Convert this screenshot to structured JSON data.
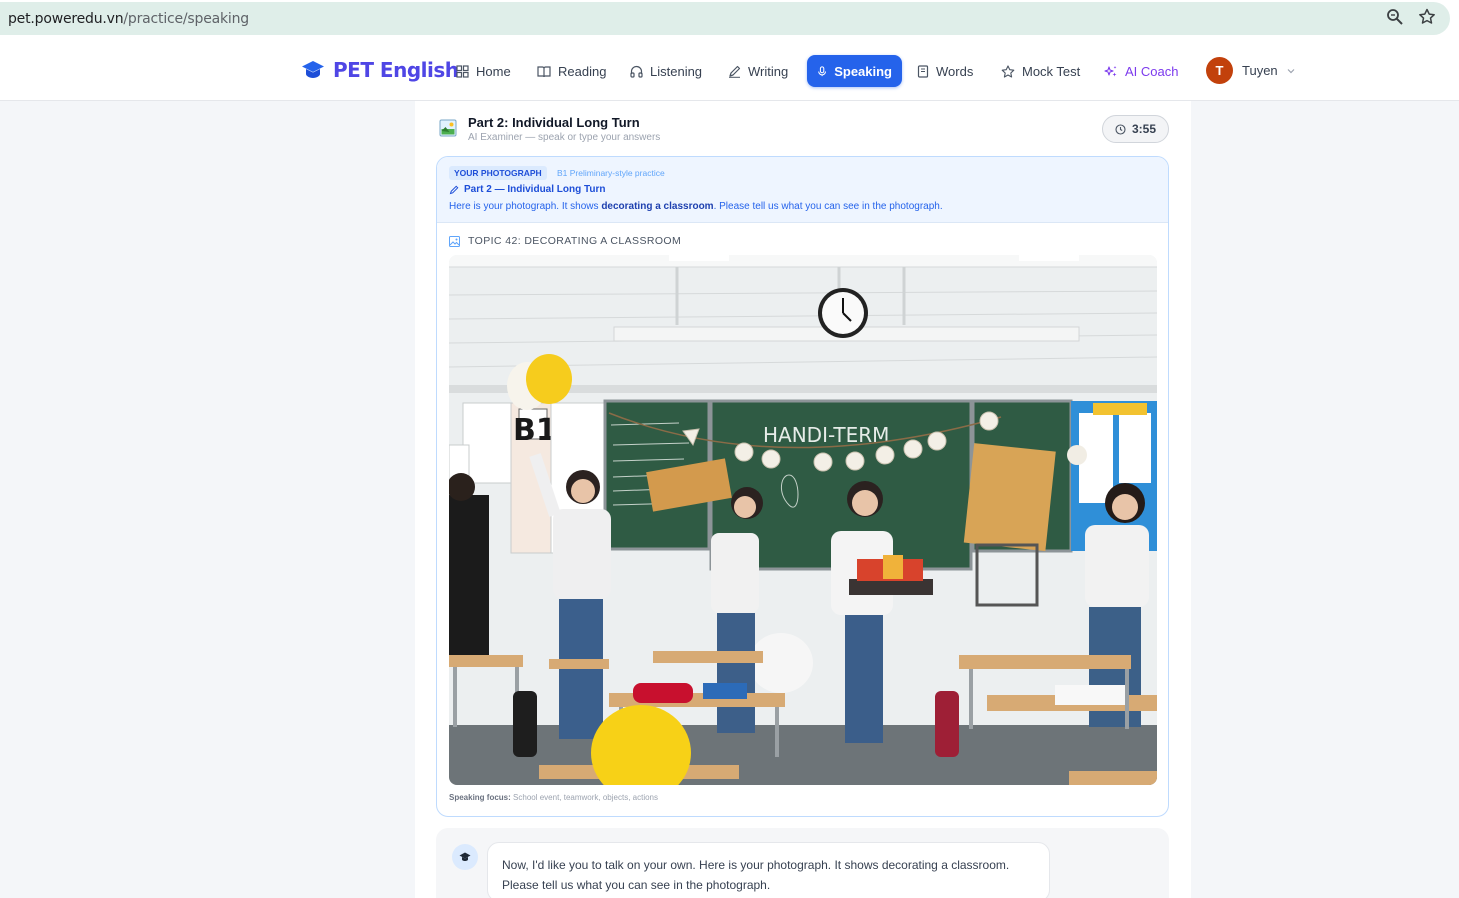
{
  "browser": {
    "url_host": "pet.poweredu.vn",
    "url_path": "/practice/speaking",
    "icons": [
      "zoom-icon",
      "bookmark-star-icon"
    ]
  },
  "nav": {
    "brand": "PET English",
    "items": [
      {
        "label": "Home",
        "icon": "grid-icon"
      },
      {
        "label": "Reading",
        "icon": "book-open-icon"
      },
      {
        "label": "Listening",
        "icon": "headphones-icon"
      },
      {
        "label": "Writing",
        "icon": "pen-icon"
      },
      {
        "label": "Speaking",
        "icon": "mic-icon",
        "active": true
      },
      {
        "label": "Words",
        "icon": "notebook-icon"
      },
      {
        "label": "Mock Test",
        "icon": "star-icon"
      },
      {
        "label": "AI Coach",
        "icon": "sparkles-icon"
      }
    ],
    "user": {
      "initial": "T",
      "name": "Tuyen"
    }
  },
  "session": {
    "title": "Part 2: Individual Long Turn",
    "subtitle": "AI Examiner — speak or type your answers",
    "timer": "3:55"
  },
  "photo_card": {
    "badge": "YOUR PHOTOGRAPH",
    "badge_note": "B1 Preliminary-style practice",
    "part_label": "Part 2 — Individual Long Turn",
    "instruction_before": "Here is your photograph. It shows ",
    "instruction_bold": "decorating a classroom",
    "instruction_after": ". Please tell us what you can see in the photograph.",
    "topic": "TOPIC 42: DECORATING A CLASSROOM",
    "focus_label": "Speaking focus:",
    "focus_text": "School event, teamwork, objects, actions",
    "photo_signs": {
      "level": "B1",
      "board": "HANDI-TERM"
    }
  },
  "chat": {
    "message": "Now, I'd like you to talk on your own. Here is your photograph. It shows decorating a classroom. Please tell us what you can see in the photograph."
  },
  "colors": {
    "brand": "#4f46e5",
    "active": "#2563eb",
    "coach": "#7c3aed",
    "avatar": "#c2410c",
    "board": "#2f5b44"
  }
}
